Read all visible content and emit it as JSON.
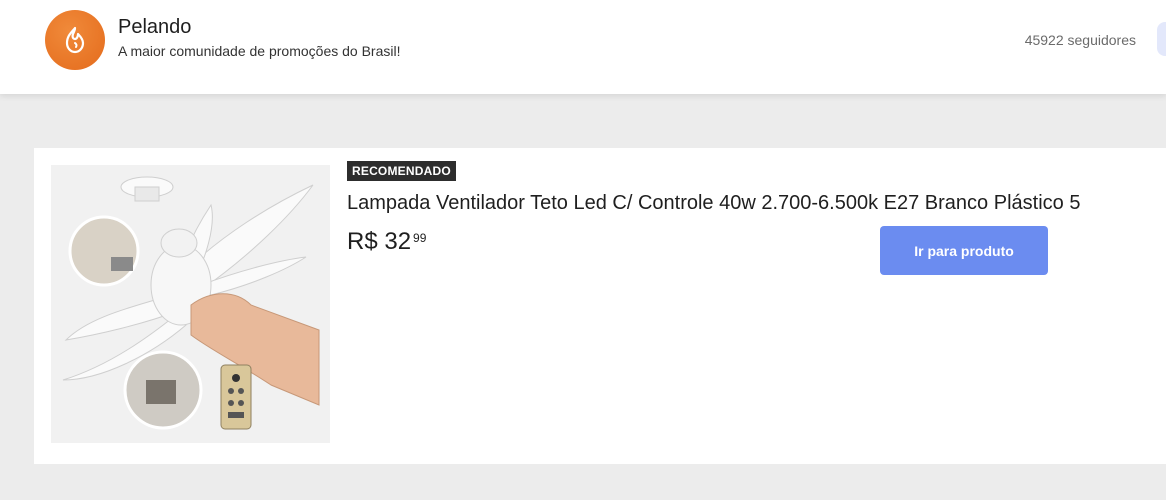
{
  "header": {
    "brand_name": "Pelando",
    "tagline": "A maior comunidade de promoções do Brasil!",
    "followers": "45922 seguidores",
    "logo_icon": "flame-icon"
  },
  "product": {
    "badge": "RECOMENDADO",
    "title": "Lampada Ventilador Teto Led C/ Controle 40w 2.700-6.500k E27 Branco Plástico 5",
    "price_main": "R$ 32",
    "price_cents": "99",
    "cta_label": "Ir para produto",
    "image": "ceiling-fan-lamp-with-remote"
  },
  "colors": {
    "brand": "#e46b1c",
    "cta": "#6b8cf0",
    "badge": "#2d2d2d"
  }
}
